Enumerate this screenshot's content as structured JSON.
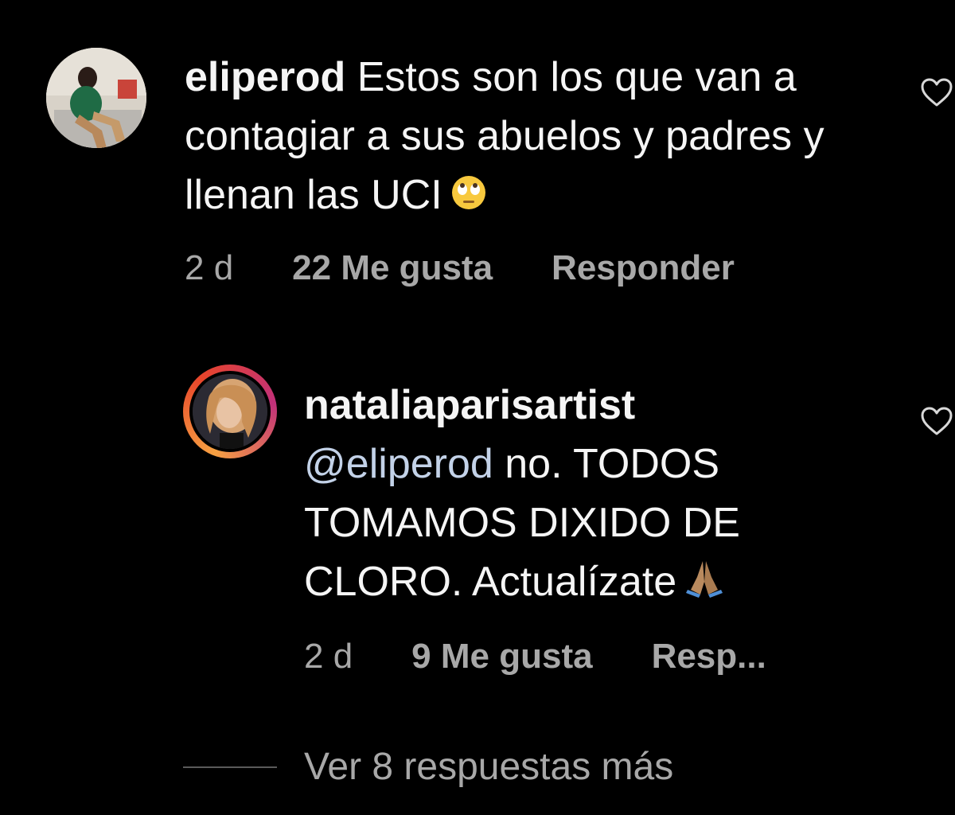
{
  "comments": [
    {
      "username": "eliperod",
      "text": "Estos son los que van a contagiar a sus abuelos y padres y llenan las UCI",
      "emoji": "face-with-rolling-eyes",
      "time": "2 d",
      "likes": "22 Me gusta",
      "reply": "Responder"
    },
    {
      "username": "nataliaparisartist",
      "mention": "@eliperod",
      "text": "no. TODOS TOMAMOS DIXIDO DE CLORO. Actualízate",
      "emoji": "folded-hands",
      "time": "2 d",
      "likes": "9 Me gusta",
      "reply": "Resp..."
    }
  ],
  "view_more_replies": "Ver 8 respuestas más",
  "icons": {
    "like": "heart-outline-icon"
  },
  "colors": {
    "background": "#000000",
    "text": "#f5f5f5",
    "meta": "#a8a8a8",
    "mention": "#c3d2e8"
  }
}
